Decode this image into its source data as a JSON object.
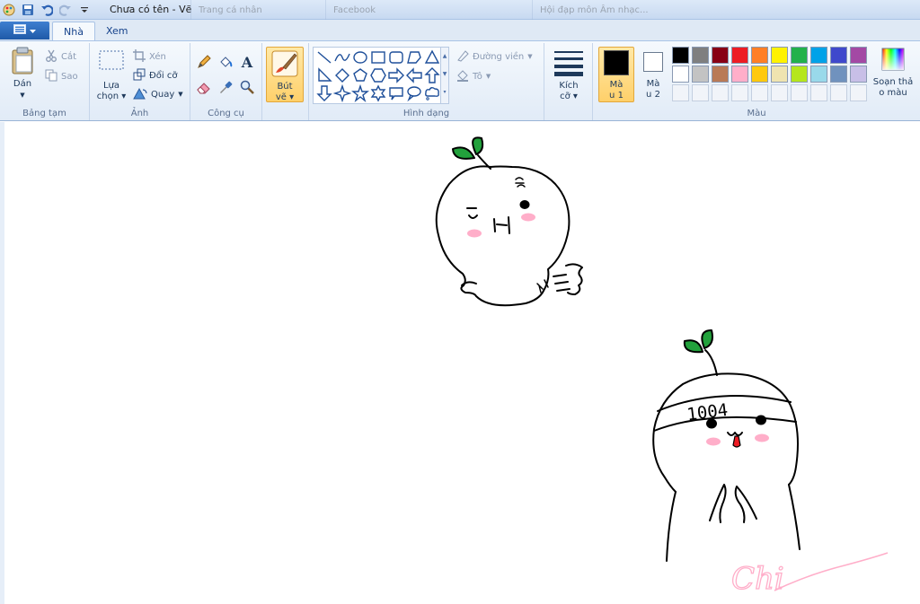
{
  "window": {
    "title": "Chưa có tên - Vẽ",
    "background_tabs": [
      "Trang cá nhân",
      "Facebook",
      "Hội đạp môn Âm nhạc..."
    ]
  },
  "qat": {
    "icons": [
      "paint-app-icon",
      "save-icon",
      "undo-icon",
      "redo-icon",
      "customize-qat-icon"
    ]
  },
  "tabs": {
    "file_menu_icon": "file-menu-icon",
    "items": [
      {
        "label": "Nhà",
        "active": true
      },
      {
        "label": "Xem",
        "active": false
      }
    ]
  },
  "clipboard": {
    "paste_label": "Dán",
    "cut_label": "Cắt",
    "copy_label": "Sao",
    "group_label": "Bảng tạm"
  },
  "image": {
    "select_label_1": "Lựa",
    "select_label_2": "chọn",
    "crop_label": "Xén",
    "resize_label": "Đổi cỡ",
    "rotate_label": "Quay",
    "group_label": "Ảnh"
  },
  "tools": {
    "group_label": "Công cụ",
    "items": [
      "pencil-icon",
      "fill-icon",
      "text-icon",
      "eraser-icon",
      "color-picker-icon",
      "magnifier-icon"
    ],
    "text_glyph": "A"
  },
  "brushes": {
    "label_1": "Bút",
    "label_2": "vẽ"
  },
  "shapes": {
    "group_label": "Hình dạng",
    "outline_label": "Đường viền",
    "fill_label": "Tô"
  },
  "size": {
    "label_1": "Kích",
    "label_2": "cỡ"
  },
  "colors": {
    "group_label": "Màu",
    "color1_label_1": "Mà",
    "color1_label_2": "u 1",
    "color2_label_1": "Mà",
    "color2_label_2": "u 2",
    "edit_label_1": "Soạn thả",
    "edit_label_2": "o màu",
    "color1_value": "#000000",
    "color2_value": "#ffffff",
    "row1": [
      "#000000",
      "#7f7f7f",
      "#880015",
      "#ed1c24",
      "#ff7f27",
      "#fff200",
      "#22b14c",
      "#00a2e8",
      "#3f48cc",
      "#a349a4"
    ],
    "row2": [
      "#ffffff",
      "#c3c3c3",
      "#b97a57",
      "#ffaec9",
      "#ffc90e",
      "#efe4b0",
      "#b5e61d",
      "#99d9ea",
      "#7092be",
      "#c8bfe7"
    ]
  },
  "drawing": {
    "headband_text": "1004",
    "signature_text": "Chi",
    "ink_color": "#000000",
    "leaf_color": "#22a13c",
    "blush_color": "#ffaec9",
    "tongue_color": "#ed1c24"
  }
}
